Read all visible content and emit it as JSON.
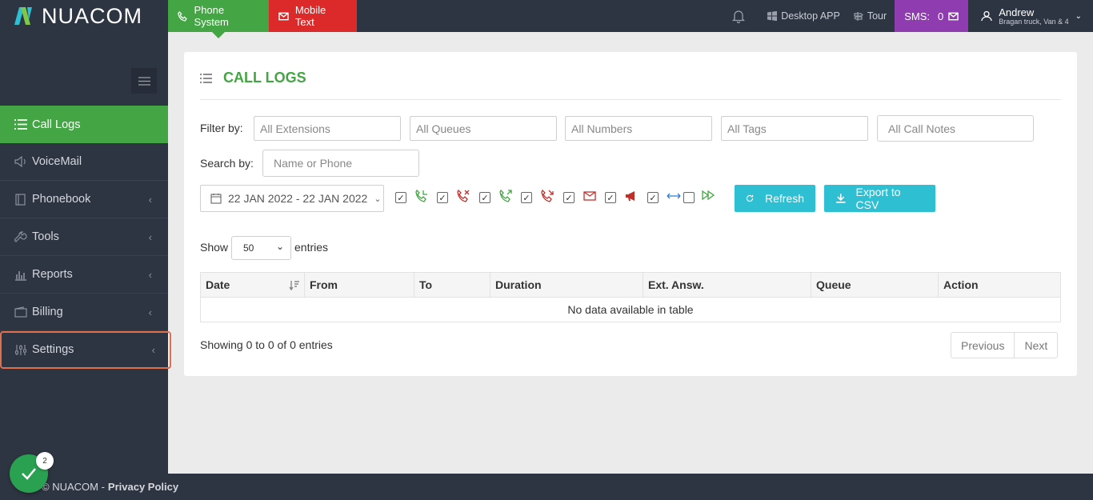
{
  "brand": {
    "logo_text": "NUACOM"
  },
  "topbar": {
    "phone_tab": "Phone System",
    "mobile_tab": "Mobile Text",
    "desktop_app": "Desktop APP",
    "tour": "Tour",
    "sms_label": "SMS:",
    "sms_count": "0",
    "user_name": "Andrew",
    "user_sub": "Bragan truck, Van & 4"
  },
  "sidebar": {
    "items": [
      {
        "label": "Call Logs",
        "icon": "list-icon"
      },
      {
        "label": "VoiceMail",
        "icon": "speaker-icon"
      },
      {
        "label": "Phonebook",
        "icon": "book-icon"
      },
      {
        "label": "Tools",
        "icon": "wrench-icon"
      },
      {
        "label": "Reports",
        "icon": "bar-chart-icon"
      },
      {
        "label": "Billing",
        "icon": "wallet-icon"
      },
      {
        "label": "Settings",
        "icon": "sliders-icon"
      }
    ]
  },
  "main": {
    "title": "CALL LOGS",
    "filter_label": "Filter by:",
    "filters": [
      "All Extensions",
      "All Queues",
      "All Numbers",
      "All Tags",
      "All Call Notes"
    ],
    "search_label": "Search by:",
    "search_placeholder": "Name or Phone",
    "date_range": "22 JAN 2022 - 22 JAN 2022",
    "refresh_label": "Refresh",
    "export_label": "Export to CSV",
    "show_label": "Show",
    "entries_value": "50",
    "entries_label": "entries",
    "table": {
      "columns": [
        "Date",
        "From",
        "To",
        "Duration",
        "Ext. Answ.",
        "Queue",
        "Action"
      ],
      "empty_text": "No data available in table"
    },
    "showing_text": "Showing 0 to 0 of 0 entries",
    "prev_label": "Previous",
    "next_label": "Next"
  },
  "footer": {
    "copyright": "© NUACOM -",
    "privacy": "Privacy Policy"
  },
  "notification_badge": "2",
  "colors": {
    "green": "#43a543",
    "red": "#dc2a2a",
    "purple": "#8e3cb0",
    "cyan": "#2fbfd2",
    "dark": "#2e3542"
  }
}
